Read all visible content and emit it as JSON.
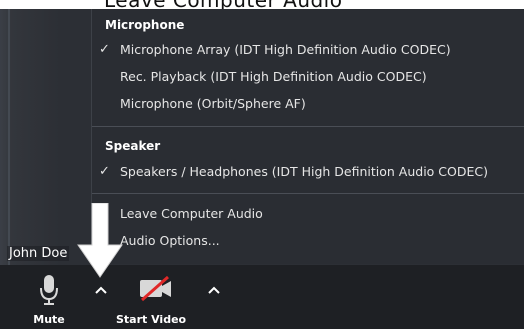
{
  "top_title": "Leave Computer Audio",
  "audio_menu": {
    "microphone_header": "Microphone",
    "microphones": [
      {
        "label": "Microphone Array (IDT High Definition Audio CODEC)",
        "checked": true
      },
      {
        "label": "Rec. Playback (IDT High Definition Audio CODEC)",
        "checked": false
      },
      {
        "label": "Microphone (Orbit/Sphere AF)",
        "checked": false
      }
    ],
    "speaker_header": "Speaker",
    "speakers": [
      {
        "label": "Speakers / Headphones (IDT High Definition Audio CODEC)",
        "checked": true
      }
    ],
    "leave_audio": "Leave Computer Audio",
    "audio_options": "Audio Options...",
    "check_mark": "✓"
  },
  "participant": {
    "name": "John Doe"
  },
  "toolbar": {
    "mute_label": "Mute",
    "start_video_label": "Start Video"
  },
  "icons": {
    "microphone": "microphone-icon",
    "video": "video-camera-off-icon",
    "caret": "chevron-up-icon",
    "cursor": "arrow-cursor-icon"
  },
  "colors": {
    "menu_bg": "#2a2d33",
    "toolbar_bg": "#1e2024",
    "video_off_slash": "#e02828",
    "text": "#e6e6e6"
  }
}
